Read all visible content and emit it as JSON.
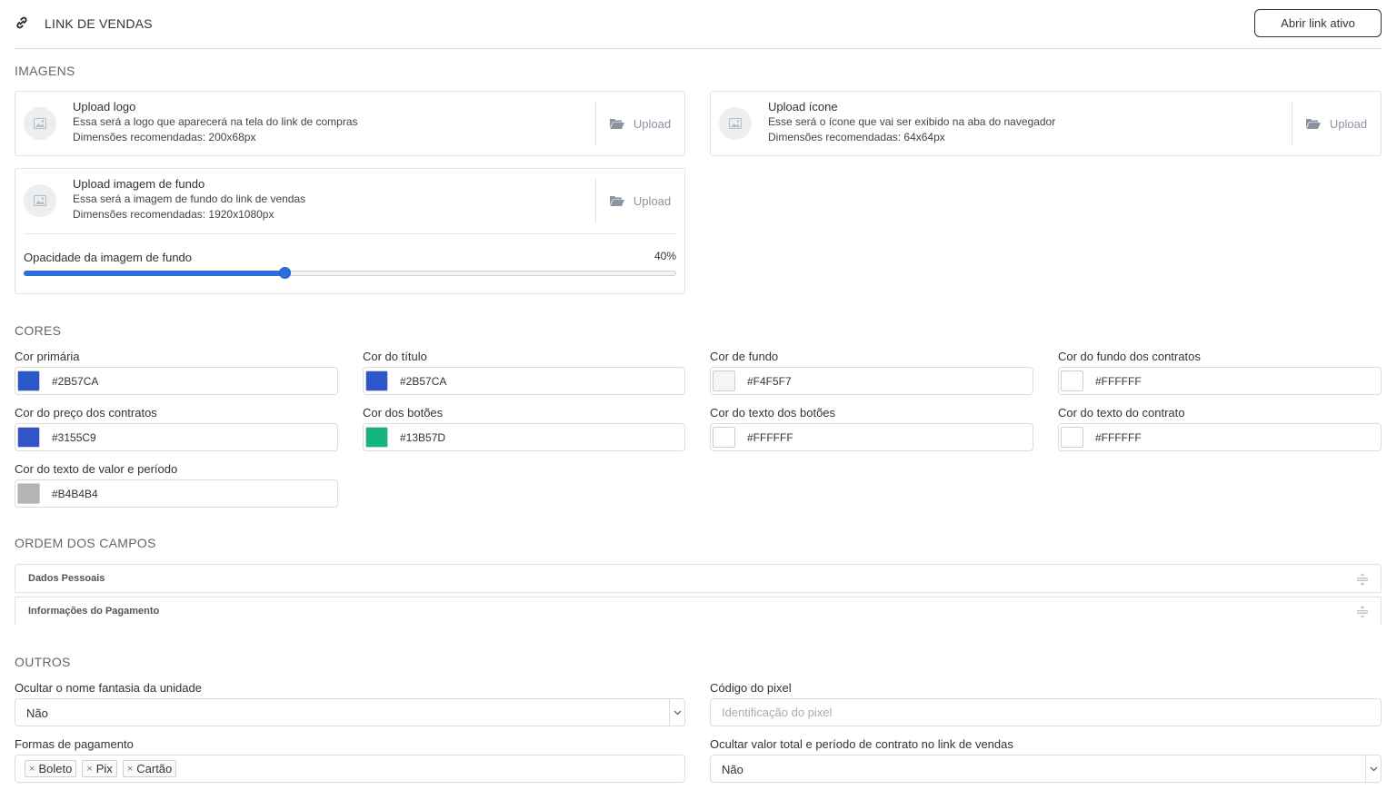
{
  "header": {
    "title": "LINK DE VENDAS",
    "open_button": "Abrir link ativo"
  },
  "sections": {
    "images": "IMAGENS",
    "colors": "CORES",
    "order": "ORDEM DOS CAMPOS",
    "others": "OUTROS"
  },
  "images": {
    "logo": {
      "title": "Upload logo",
      "desc": "Essa será a logo que aparecerá na tela do link de compras",
      "dims": "Dimensões recomendadas: 200x68px",
      "button": "Upload"
    },
    "icon": {
      "title": "Upload ícone",
      "desc": "Esse será o ícone que vai ser exibido na aba do navegador",
      "dims": "Dimensões recomendadas: 64x64px",
      "button": "Upload"
    },
    "background": {
      "title": "Upload imagem de fundo",
      "desc": "Essa será a imagem de fundo do link de vendas",
      "dims": "Dimensões recomendadas: 1920x1080px",
      "button": "Upload"
    },
    "opacity": {
      "label": "Opacidade da imagem de fundo",
      "value_text": "40%",
      "value": 40
    }
  },
  "colors": [
    {
      "label": "Cor primária",
      "value": "#2B57CA",
      "swatch": "#2B57CA"
    },
    {
      "label": "Cor do título",
      "value": "#2B57CA",
      "swatch": "#2B57CA"
    },
    {
      "label": "Cor de fundo",
      "value": "#F4F5F7",
      "swatch": "#F4F5F7"
    },
    {
      "label": "Cor do fundo dos contratos",
      "value": "#FFFFFF",
      "swatch": "#FFFFFF"
    },
    {
      "label": "Cor do preço dos contratos",
      "value": "#3155C9",
      "swatch": "#3155C9"
    },
    {
      "label": "Cor dos botões",
      "value": "#13B57D",
      "swatch": "#13B57D"
    },
    {
      "label": "Cor do texto dos botões",
      "value": "#FFFFFF",
      "swatch": "#FFFFFF"
    },
    {
      "label": "Cor do texto do contrato",
      "value": "#FFFFFF",
      "swatch": "#FFFFFF"
    },
    {
      "label": "Cor do texto de valor e período",
      "value": "#B4B4B4",
      "swatch": "#B4B4B4"
    }
  ],
  "order": [
    {
      "label": "Dados Pessoais"
    },
    {
      "label": "Informações do Pagamento"
    }
  ],
  "others": {
    "hide_name": {
      "label": "Ocultar o nome fantasia da unidade",
      "value": "Não"
    },
    "pixel": {
      "label": "Código do pixel",
      "placeholder": "Identificação do pixel"
    },
    "payments": {
      "label": "Formas de pagamento",
      "tags": [
        "Boleto",
        "Pix",
        "Cartão"
      ]
    },
    "hide_total": {
      "label": "Ocultar valor total e período de contrato no link de vendas",
      "value": "Não"
    }
  },
  "icons": {
    "link": "link-icon",
    "image": "image-placeholder-icon",
    "folder": "folder-open-icon",
    "drag": "drag-handle-icon",
    "chevron": "chevron-down-icon",
    "remove": "remove-tag-icon"
  }
}
